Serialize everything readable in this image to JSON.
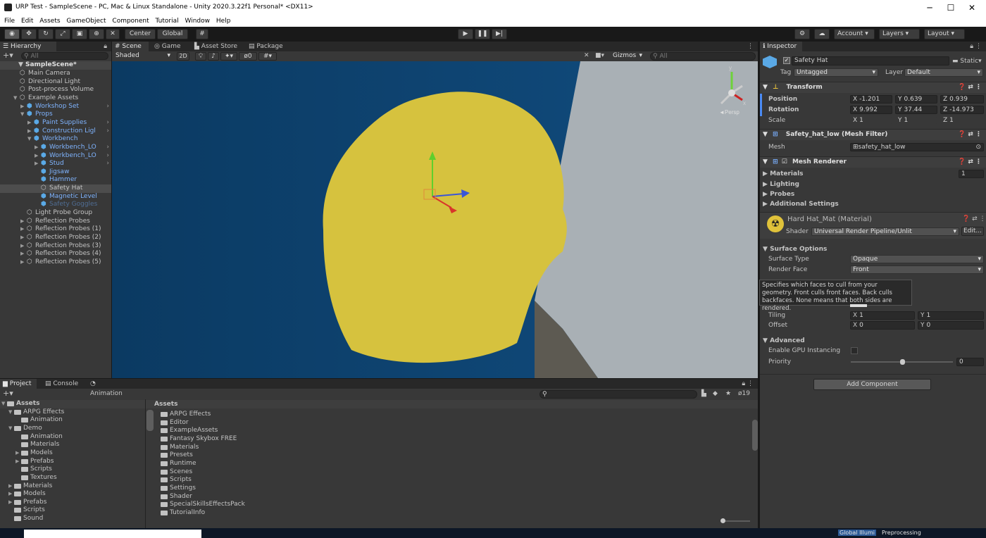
{
  "window": {
    "title": "URP Test - SampleScene - PC, Mac & Linux Standalone - Unity 2020.3.22f1 Personal* <DX11>",
    "minimize": "─",
    "maximize": "☐",
    "close": "✕"
  },
  "menu": [
    "File",
    "Edit",
    "Assets",
    "GameObject",
    "Component",
    "Tutorial",
    "Window",
    "Help"
  ],
  "toolbar": {
    "pivot": "Center",
    "space": "Global",
    "account": "Account",
    "layers": "Layers",
    "layout": "Layout",
    "play": "▶",
    "pause": "❚❚",
    "step": "▶|"
  },
  "hierarchy": {
    "tab": "Hierarchy",
    "search_placeholder": "All",
    "scene": "SampleScene*",
    "items": [
      {
        "label": "Main Camera",
        "indent": 1,
        "color": "w"
      },
      {
        "label": "Directional Light",
        "indent": 1,
        "color": "w"
      },
      {
        "label": "Post-process Volume",
        "indent": 1,
        "color": "w"
      },
      {
        "label": "Example Assets",
        "indent": 1,
        "color": "w",
        "arrow": "▼"
      },
      {
        "label": "Workshop Set",
        "indent": 2,
        "color": "b",
        "arrow": "▶"
      },
      {
        "label": "Props",
        "indent": 2,
        "color": "b",
        "arrow": "▼"
      },
      {
        "label": "Paint Supplies",
        "indent": 3,
        "color": "b",
        "arrow": "▶"
      },
      {
        "label": "Construction Ligl",
        "indent": 3,
        "color": "b",
        "arrow": "▶"
      },
      {
        "label": "Workbench",
        "indent": 3,
        "color": "b",
        "arrow": "▼"
      },
      {
        "label": "Workbench_LO",
        "indent": 4,
        "color": "b",
        "arrow": "▶"
      },
      {
        "label": "Workbench_LO",
        "indent": 4,
        "color": "b",
        "arrow": "▶"
      },
      {
        "label": "Stud",
        "indent": 4,
        "color": "b",
        "arrow": "▶"
      },
      {
        "label": "Jigsaw",
        "indent": 4,
        "color": "b"
      },
      {
        "label": "Hammer",
        "indent": 4,
        "color": "b"
      },
      {
        "label": "Safety Hat",
        "indent": 4,
        "color": "w",
        "selected": true
      },
      {
        "label": "Magnetic Level",
        "indent": 4,
        "color": "b"
      },
      {
        "label": "Safety Goggles",
        "indent": 4,
        "color": "d"
      },
      {
        "label": "Light Probe Group",
        "indent": 2,
        "color": "w"
      },
      {
        "label": "Reflection Probes",
        "indent": 2,
        "color": "w",
        "arrow": "▶"
      },
      {
        "label": "Reflection Probes (1)",
        "indent": 2,
        "color": "w",
        "arrow": "▶"
      },
      {
        "label": "Reflection Probes (2)",
        "indent": 2,
        "color": "w",
        "arrow": "▶"
      },
      {
        "label": "Reflection Probes (3)",
        "indent": 2,
        "color": "w",
        "arrow": "▶"
      },
      {
        "label": "Reflection Probes (4)",
        "indent": 2,
        "color": "w",
        "arrow": "▶"
      },
      {
        "label": "Reflection Probes (5)",
        "indent": 2,
        "color": "w",
        "arrow": "▶"
      }
    ]
  },
  "scene_tabs": [
    "Scene",
    "Game",
    "Asset Store",
    "Package Manager"
  ],
  "scene_toolbar": {
    "shading": "Shaded",
    "mode2d": "2D",
    "gizmos": "Gizmos",
    "search_placeholder": "All",
    "hidden_count": "0"
  },
  "scene_view": {
    "perspective": "◄Persp",
    "axis_y": "y",
    "axis_x": "x"
  },
  "inspector": {
    "tab": "Inspector",
    "object_name": "Safety Hat",
    "static": "Static",
    "tag_label": "Tag",
    "tag": "Untagged",
    "layer_label": "Layer",
    "layer": "Default",
    "transform": {
      "title": "Transform",
      "position_label": "Position",
      "rotation_label": "Rotation",
      "scale_label": "Scale",
      "position": {
        "x": "-1.201",
        "y": "0.639",
        "z": "0.939"
      },
      "rotation": {
        "x": "9.992",
        "y": "37.44",
        "z": "-14.973"
      },
      "scale": {
        "x": "1",
        "y": "1",
        "z": "1"
      }
    },
    "mesh_filter": {
      "title": "Safety_hat_low (Mesh Filter)",
      "mesh_label": "Mesh",
      "mesh": "safety_hat_low"
    },
    "mesh_renderer": {
      "title": "Mesh Renderer",
      "materials": "Materials",
      "materials_count": "1",
      "lighting": "Lighting",
      "probes": "Probes",
      "additional": "Additional Settings"
    },
    "material": {
      "title": "Hard Hat_Mat (Material)",
      "shader_label": "Shader",
      "shader": "Universal Render Pipeline/Unlit",
      "edit": "Edit..."
    },
    "surface": {
      "title": "Surface Options",
      "type_label": "Surface Type",
      "type": "Opaque",
      "face_label": "Render Face",
      "face": "Front"
    },
    "tooltip": "Specifies which faces to cull from your geometry. Front culls front faces. Back culls backfaces. None means that both sides are rendered.",
    "tiling": {
      "label": "Tiling",
      "x": "1",
      "y": "1"
    },
    "offset": {
      "label": "Offset",
      "x": "0",
      "y": "0"
    },
    "advanced": {
      "title": "Advanced",
      "gpu": "Enable GPU Instancing",
      "priority_label": "Priority",
      "priority": "0",
      "priority_fraction": 0.5
    },
    "add_component": "Add Component",
    "axis": {
      "x": "X",
      "y": "Y",
      "z": "Z"
    }
  },
  "bottom_tabs": [
    "Project",
    "Console",
    "Animation"
  ],
  "project": {
    "hidden_count": "19",
    "tree": [
      {
        "label": "Assets",
        "indent": 0,
        "arrow": "▼",
        "bold": true
      },
      {
        "label": "ARPG Effects",
        "indent": 1,
        "arrow": "▼"
      },
      {
        "label": "Animation",
        "indent": 2
      },
      {
        "label": "Demo",
        "indent": 1,
        "arrow": "▼"
      },
      {
        "label": "Animation",
        "indent": 2
      },
      {
        "label": "Materials",
        "indent": 2
      },
      {
        "label": "Models",
        "indent": 2,
        "arrow": "▶"
      },
      {
        "label": "Prefabs",
        "indent": 2,
        "arrow": "▶"
      },
      {
        "label": "Scripts",
        "indent": 2
      },
      {
        "label": "Textures",
        "indent": 2
      },
      {
        "label": "Materials",
        "indent": 1,
        "arrow": "▶"
      },
      {
        "label": "Models",
        "indent": 1,
        "arrow": "▶"
      },
      {
        "label": "Prefabs",
        "indent": 1,
        "arrow": "▶"
      },
      {
        "label": "Scripts",
        "indent": 1
      },
      {
        "label": "Sound",
        "indent": 1
      }
    ],
    "breadcrumb": "Assets",
    "files": [
      "ARPG Effects",
      "Editor",
      "ExampleAssets",
      "Fantasy Skybox FREE",
      "Materials",
      "Presets",
      "Runtime",
      "Scenes",
      "Scripts",
      "Settings",
      "Shader",
      "SpecialSkillsEffectsPack",
      "TutorialInfo"
    ]
  },
  "status": {
    "global_illum": "Global Illumi",
    "preprocessing": "Preprocessing"
  },
  "colors": {
    "hat": "#d6c23e",
    "wall": "#0f4572",
    "accent": "#7fb4ff",
    "select": "#4d4d4d"
  }
}
